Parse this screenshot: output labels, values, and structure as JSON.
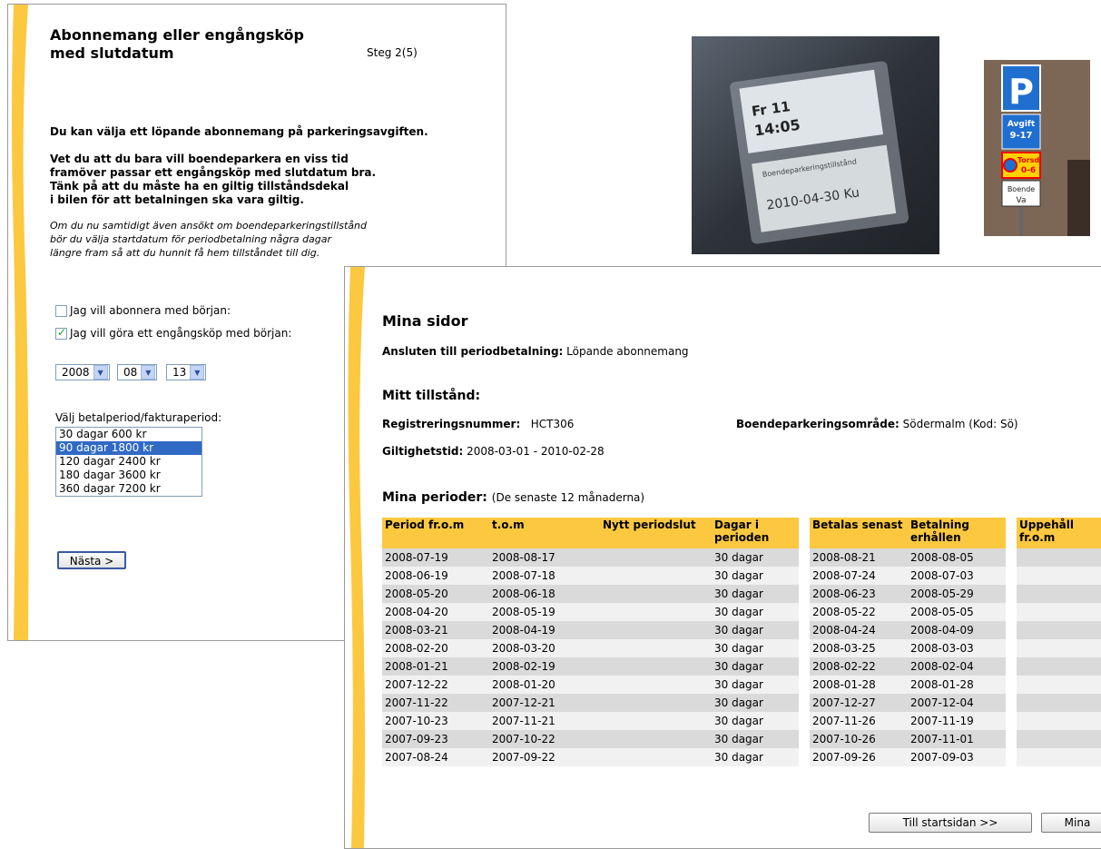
{
  "back_window": {
    "title": "Abonnemang eller engångsköp med slutdatum",
    "step": "Steg 2(5)",
    "intro": "Du kan välja ett löpande abonnemang på parkeringsavgiften.",
    "info_lines": [
      "Vet du att du bara vill boendeparkera en viss tid",
      "framöver passar ett engångsköp med slutdatum bra.",
      "Tänk på att du måste ha en giltig tillståndsdekal",
      "i bilen för att betalningen ska vara giltig."
    ],
    "note_lines": [
      "Om du nu samtidigt även ansökt om boendeparkeringstillstånd",
      "bör du välja startdatum för periodbetalning några dagar",
      "längre fram så att du hunnit få hem tillståndet till dig."
    ],
    "option_subscribe": "Jag vill abonnera med början:",
    "option_single": "Jag vill göra ett engångsköp med början:",
    "year": "2008",
    "month": "08",
    "day": "13",
    "period_label": "Välj betalperiod/fakturaperiod:",
    "period_options": [
      "30 dagar 600 kr",
      "90 dagar 1800 kr",
      "120 dagar 2400 kr",
      "180 dagar 3600 kr",
      "360 dagar 7200 kr"
    ],
    "next_button": "Nästa >"
  },
  "photo_permit": {
    "ticket_day": "Fr 11",
    "ticket_time": "14:05",
    "permit_label": "Boendeparkeringstillstånd",
    "permit_date": "2010-04-30 Ku"
  },
  "photo_sign": {
    "p": "P",
    "avgift": "Avgift",
    "hours": "9-17",
    "torsd": "Torsd",
    "torsd_hours": "0-6",
    "boende": "Boende",
    "area": "Va"
  },
  "front_window": {
    "title": "Mina sidor",
    "connected_label": "Ansluten till periodbetalning:",
    "connected_value": "Löpande abonnemang",
    "permit_heading": "Mitt tillstånd:",
    "reg_label": "Registreringsnummer:",
    "reg_value": "HCT306",
    "area_label": "Boendeparkeringsområde:",
    "area_value": "Södermalm (Kod: Sö)",
    "validity_label": "Giltighetstid:",
    "validity_value": "2008-03-01 - 2010-02-28",
    "periods_heading": "Mina perioder:",
    "periods_note": "(De senaste 12 månaderna)",
    "columns": [
      "Period fr.o.m",
      "t.o.m",
      "Nytt periodslut",
      "Dagar i perioden",
      "Betalas senast",
      "Betalning erhållen",
      "Uppehåll fr.o.m"
    ],
    "rows": [
      [
        "2008-07-19",
        "2008-08-17",
        "",
        "30 dagar",
        "2008-08-21",
        "2008-08-05",
        ""
      ],
      [
        "2008-06-19",
        "2008-07-18",
        "",
        "30 dagar",
        "2008-07-24",
        "2008-07-03",
        ""
      ],
      [
        "2008-05-20",
        "2008-06-18",
        "",
        "30 dagar",
        "2008-06-23",
        "2008-05-29",
        ""
      ],
      [
        "2008-04-20",
        "2008-05-19",
        "",
        "30 dagar",
        "2008-05-22",
        "2008-05-05",
        ""
      ],
      [
        "2008-03-21",
        "2008-04-19",
        "",
        "30 dagar",
        "2008-04-24",
        "2008-04-09",
        ""
      ],
      [
        "2008-02-20",
        "2008-03-20",
        "",
        "30 dagar",
        "2008-03-25",
        "2008-03-03",
        ""
      ],
      [
        "2008-01-21",
        "2008-02-19",
        "",
        "30 dagar",
        "2008-02-22",
        "2008-02-04",
        ""
      ],
      [
        "2007-12-22",
        "2008-01-20",
        "",
        "30 dagar",
        "2008-01-28",
        "2008-01-28",
        ""
      ],
      [
        "2007-11-22",
        "2007-12-21",
        "",
        "30 dagar",
        "2007-12-27",
        "2007-12-04",
        ""
      ],
      [
        "2007-10-23",
        "2007-11-21",
        "",
        "30 dagar",
        "2007-11-26",
        "2007-11-19",
        ""
      ],
      [
        "2007-09-23",
        "2007-10-22",
        "",
        "30 dagar",
        "2007-10-26",
        "2007-11-01",
        ""
      ],
      [
        "2007-08-24",
        "2007-09-22",
        "",
        "30 dagar",
        "2007-09-26",
        "2007-09-03",
        ""
      ]
    ],
    "btn_start": "Till startsidan >>",
    "btn_mina": "Mina"
  },
  "colors": {
    "accent": "#fbc840",
    "selection": "#316ac5",
    "row_odd": "#dadada",
    "row_even": "#f1f1f1"
  }
}
